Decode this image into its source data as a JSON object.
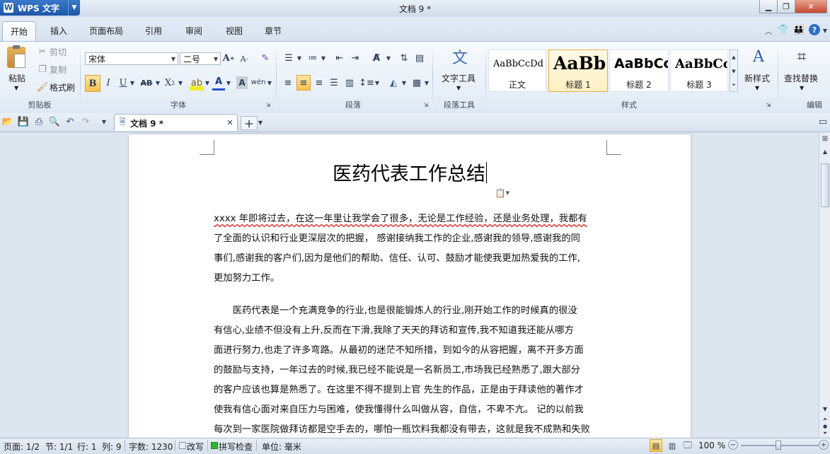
{
  "app": {
    "name": "WPS 文字",
    "document_title": "文档 9 *"
  },
  "tabs": [
    "开始",
    "插入",
    "页面布局",
    "引用",
    "审阅",
    "视图",
    "章节"
  ],
  "active_tab": "开始",
  "clipboard": {
    "paste": "粘贴",
    "cut": "剪切",
    "copy": "复制",
    "format_painter": "格式刷",
    "group": "剪贴板"
  },
  "font": {
    "family": "宋体",
    "size": "二号",
    "group": "字体"
  },
  "paragraph": {
    "group": "段落"
  },
  "para_tools": {
    "label": "文字工具",
    "group": "段落工具"
  },
  "styles": {
    "items": [
      {
        "sample": "AaBbCcDd",
        "name": "正文"
      },
      {
        "sample": "AaBb(",
        "name": "标题 1"
      },
      {
        "sample": "AaBbCc",
        "name": "标题 2"
      },
      {
        "sample": "AaBbCc",
        "name": "标题 3"
      }
    ],
    "new_style": "新样式",
    "group": "样式"
  },
  "edit": {
    "find_replace": "查找替换",
    "group": "编辑"
  },
  "doc_tab": {
    "label": "文档 9 *"
  },
  "document": {
    "heading": "医药代表工作总结",
    "paragraphs": [
      {
        "lines": [
          "xxxx 年即将过去，在这一年里让我学会了很多，无论是工作经验，还是业务处理，我都有",
          "了全面的认识和行业更深层次的把握， 感谢接纳我工作的企业,感谢我的领导,感谢我的同",
          "事们,感谢我的客户们,因为是他们的帮助、信任、认可、鼓励才能使我更加热爱我的工作,",
          "更加努力工作。"
        ]
      },
      {
        "lines": [
          "　　医药代表是一个充满竞争的行业,也是很能锻炼人的行业,刚开始工作的时候真的很没",
          "有信心,业绩不但没有上升,反而在下滑,我除了天天的拜访和宣传,我不知道我还能从哪方",
          "面进行努力,也走了许多弯路。从最初的迷茫不知所措，到如今的从容把握，离不开多方面",
          "的鼓励与支持，一年过去的时候,我已经不能说是一名新员工,市场我已经熟悉了,跟大部分",
          "的客户应该也算是熟悉了。在这里不得不提到上官 先生的作品，正是由于拜读他的著作才",
          "使我有信心面对来自压力与困难，使我懂得什么叫做从容，自信，不卑不亢。  记的以前我",
          "每次到一家医院做拜访都是空手去的，哪怕一瓶饮料我都没有带去，这就是我不成熟和失败"
        ]
      }
    ]
  },
  "status": {
    "page": "页面: 1/2",
    "section": "节: 1/1",
    "line": "行: 1",
    "column": "列: 9",
    "word_count": "字数: 1230",
    "revise": "改写",
    "spell_check": "拼写检查",
    "unit": "单位: 毫米",
    "zoom": "100 %"
  }
}
